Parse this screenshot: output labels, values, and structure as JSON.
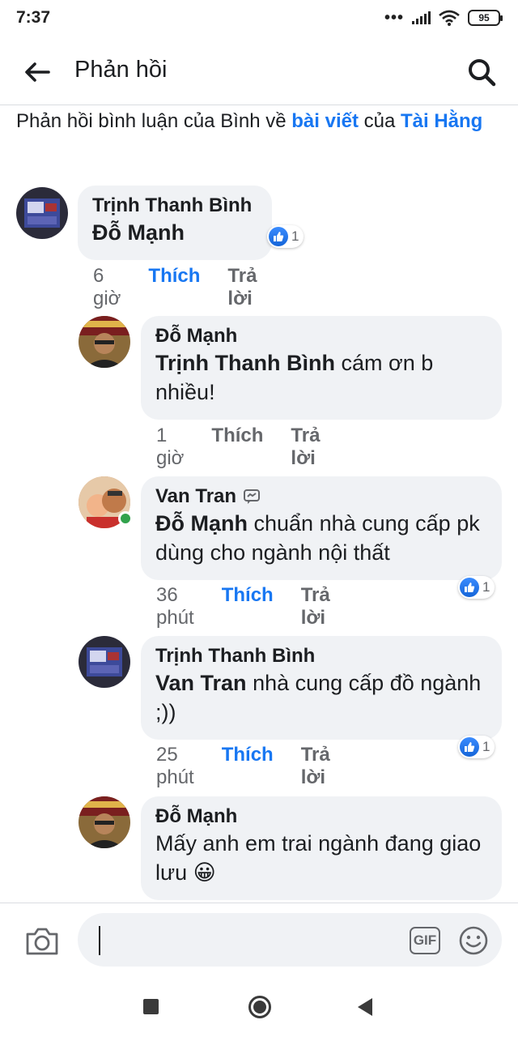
{
  "status_bar": {
    "time": "7:37",
    "battery": "95",
    "more": "•••"
  },
  "header": {
    "title": "Phản hồi"
  },
  "context": {
    "prefix": "Phản hồi bình luận của Bình về ",
    "post_link": "bài viết",
    "middle": " của ",
    "owner_link": "Tài Hằng"
  },
  "comments": [
    {
      "author": "Trịnh Thanh Bình",
      "mention": "Đỗ Mạnh",
      "text": "",
      "time": "6 giờ",
      "like": "Thích",
      "reply": "Trả lời",
      "reaction_count": "1",
      "liked": true
    },
    {
      "author": "Đỗ Mạnh",
      "mention": "Trịnh Thanh Bình",
      "text": " cám ơn b nhiều!",
      "time": "1 giờ",
      "like": "Thích",
      "reply": "Trả lời",
      "liked": false
    },
    {
      "author": "Van Tran",
      "mention": "Đỗ Mạnh",
      "text": " chuẩn nhà cung cấp pk dùng cho ngành nội thất",
      "time": "36 phút",
      "like": "Thích",
      "reply": "Trả lời",
      "reaction_count": "1",
      "liked": true
    },
    {
      "author": "Trịnh Thanh Bình",
      "mention": "Van Tran",
      "text": " nhà cung cấp đồ ngành ;))",
      "time": "25 phút",
      "like": "Thích",
      "reply": "Trả lời",
      "reaction_count": "1",
      "liked": true
    },
    {
      "author": "Đỗ Mạnh",
      "mention": "",
      "text": "Mấy anh em trai ngành đang giao lưu 😀",
      "liked": false
    }
  ],
  "composer": {
    "gif_label": "GIF"
  },
  "colors": {
    "accent": "#1877f2",
    "bubble": "#f0f2f5",
    "muted": "#65676b",
    "online": "#31a24c"
  }
}
